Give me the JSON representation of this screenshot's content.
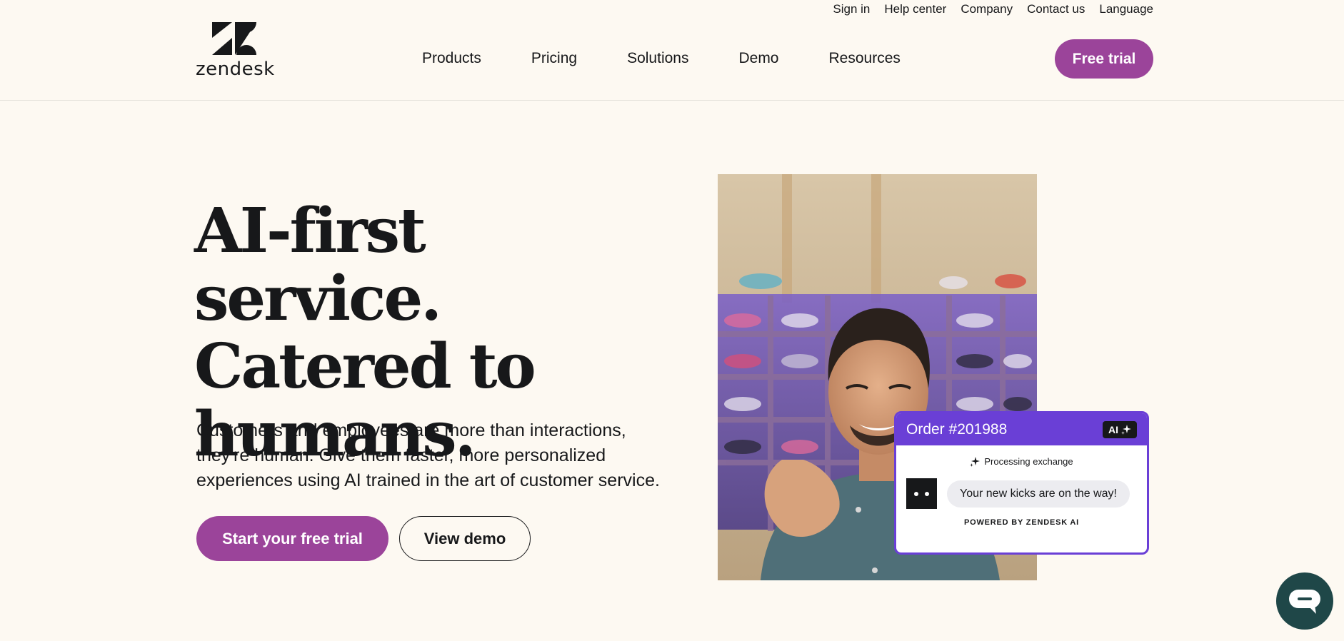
{
  "header": {
    "logo_text": "zendesk",
    "utility_links": [
      "Sign in",
      "Help center",
      "Company",
      "Contact us",
      "Language"
    ],
    "nav": [
      "Products",
      "Pricing",
      "Solutions",
      "Demo",
      "Resources"
    ],
    "cta_label": "Free trial"
  },
  "hero": {
    "title_lines": [
      "AI-first service.",
      "Catered to",
      "humans."
    ],
    "subtitle": "Customers and employees are more than interactions, they're human. Give them faster, more personalized experiences using AI trained in the art of customer service.",
    "primary_button": "Start your free trial",
    "secondary_button": "View demo"
  },
  "order_card": {
    "title": "Order #201988",
    "badge": "AI",
    "status": "Processing exchange",
    "message": "Your new kicks are on the way!",
    "footer": "POWERED BY ZENDESK AI"
  },
  "icons": {
    "logo": "zendesk-logo-icon",
    "sparkle": "sparkle-icon",
    "bot": "bot-avatar-icon",
    "chat": "chat-bubble-icon"
  },
  "colors": {
    "background": "#fdf9f2",
    "brand_purple": "#9b449a",
    "card_purple": "#6a3fd6",
    "chat_widget": "#1f4748",
    "text": "#17181a"
  }
}
